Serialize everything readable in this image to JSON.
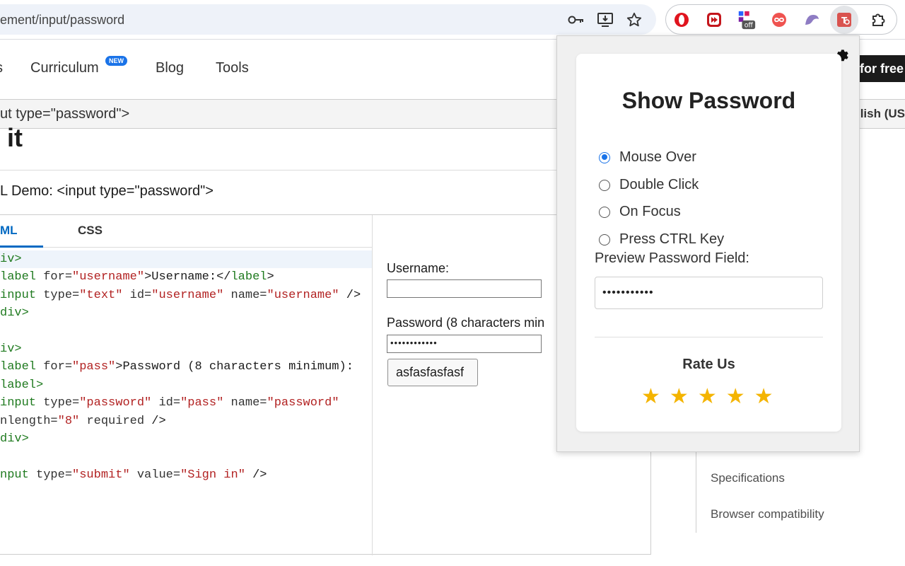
{
  "browser": {
    "url": "ement/input/password"
  },
  "header": {
    "nav_left_fragment": "s",
    "nav": [
      "Curriculum",
      "Blog",
      "Tools"
    ],
    "new_badge": "NEW",
    "cta_fragment": "for free"
  },
  "breadcrumb": {
    "text": "ut type=\"password\">",
    "lang_fragment": "lish (US"
  },
  "page": {
    "title_fragment": "it",
    "demo_title": "L Demo: <input type=\"password\">"
  },
  "demo": {
    "tabs": [
      "ML",
      "CSS"
    ],
    "output": {
      "username_label": "Username:",
      "password_label": "Password (8 characters min",
      "password_mask": "••••••••••••",
      "submit_label": "asfasfasfasf"
    }
  },
  "sidebar": {
    "links": [
      "Specifications",
      "Browser compatibility"
    ]
  },
  "popup": {
    "title": "Show Password",
    "options": [
      "Mouse Over",
      "Double Click",
      "On Focus",
      "Press CTRL Key"
    ],
    "selected_option": "Mouse Over",
    "preview_label": "Preview Password Field:",
    "preview_mask": "•••••••••••",
    "rate_label": "Rate Us",
    "stars": 5,
    "accent_color": "#1a73e8",
    "star_color": "#f4b400"
  }
}
